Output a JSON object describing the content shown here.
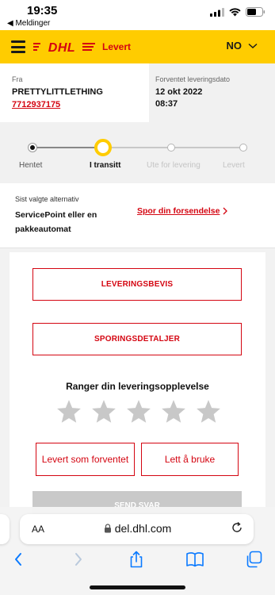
{
  "status_bar": {
    "time": "19:35",
    "back_label": "◀ Meldinger"
  },
  "header": {
    "logo_text": "DHL",
    "title": "Levert",
    "language": "NO"
  },
  "info": {
    "from_label": "Fra",
    "from_name": "PRETTYLITTLETHING",
    "tracking_number": "7712937175",
    "expected_label": "Forventet leveringsdato",
    "expected_date": "12 okt 2022",
    "expected_time": "08:37"
  },
  "progress": {
    "steps": [
      {
        "label": "Hentet",
        "state": "done"
      },
      {
        "label": "I transitt",
        "state": "current"
      },
      {
        "label": "Ute for levering",
        "state": "todo"
      },
      {
        "label": "Levert",
        "state": "todo"
      }
    ]
  },
  "alternative": {
    "label": "Sist valgte alternativ",
    "value": "ServicePoint eller en pakkeautomat",
    "link": "Spor din forsendelse"
  },
  "actions": {
    "proof_button": "LEVERINGSBEVIS",
    "details_button": "SPORINGSDETALJER"
  },
  "rating": {
    "title": "Ranger din leveringsopplevelse",
    "stars_total": 5,
    "stars_selected": 0,
    "chips": [
      "Levert som forventet",
      "Lett å bruke"
    ],
    "submit_label": "SEND SVAR"
  },
  "browser": {
    "text_size_label": "AA",
    "url": "del.dhl.com"
  },
  "colors": {
    "dhl_yellow": "#ffcc00",
    "dhl_red": "#d40511",
    "star_gray": "#c8c8c8"
  }
}
